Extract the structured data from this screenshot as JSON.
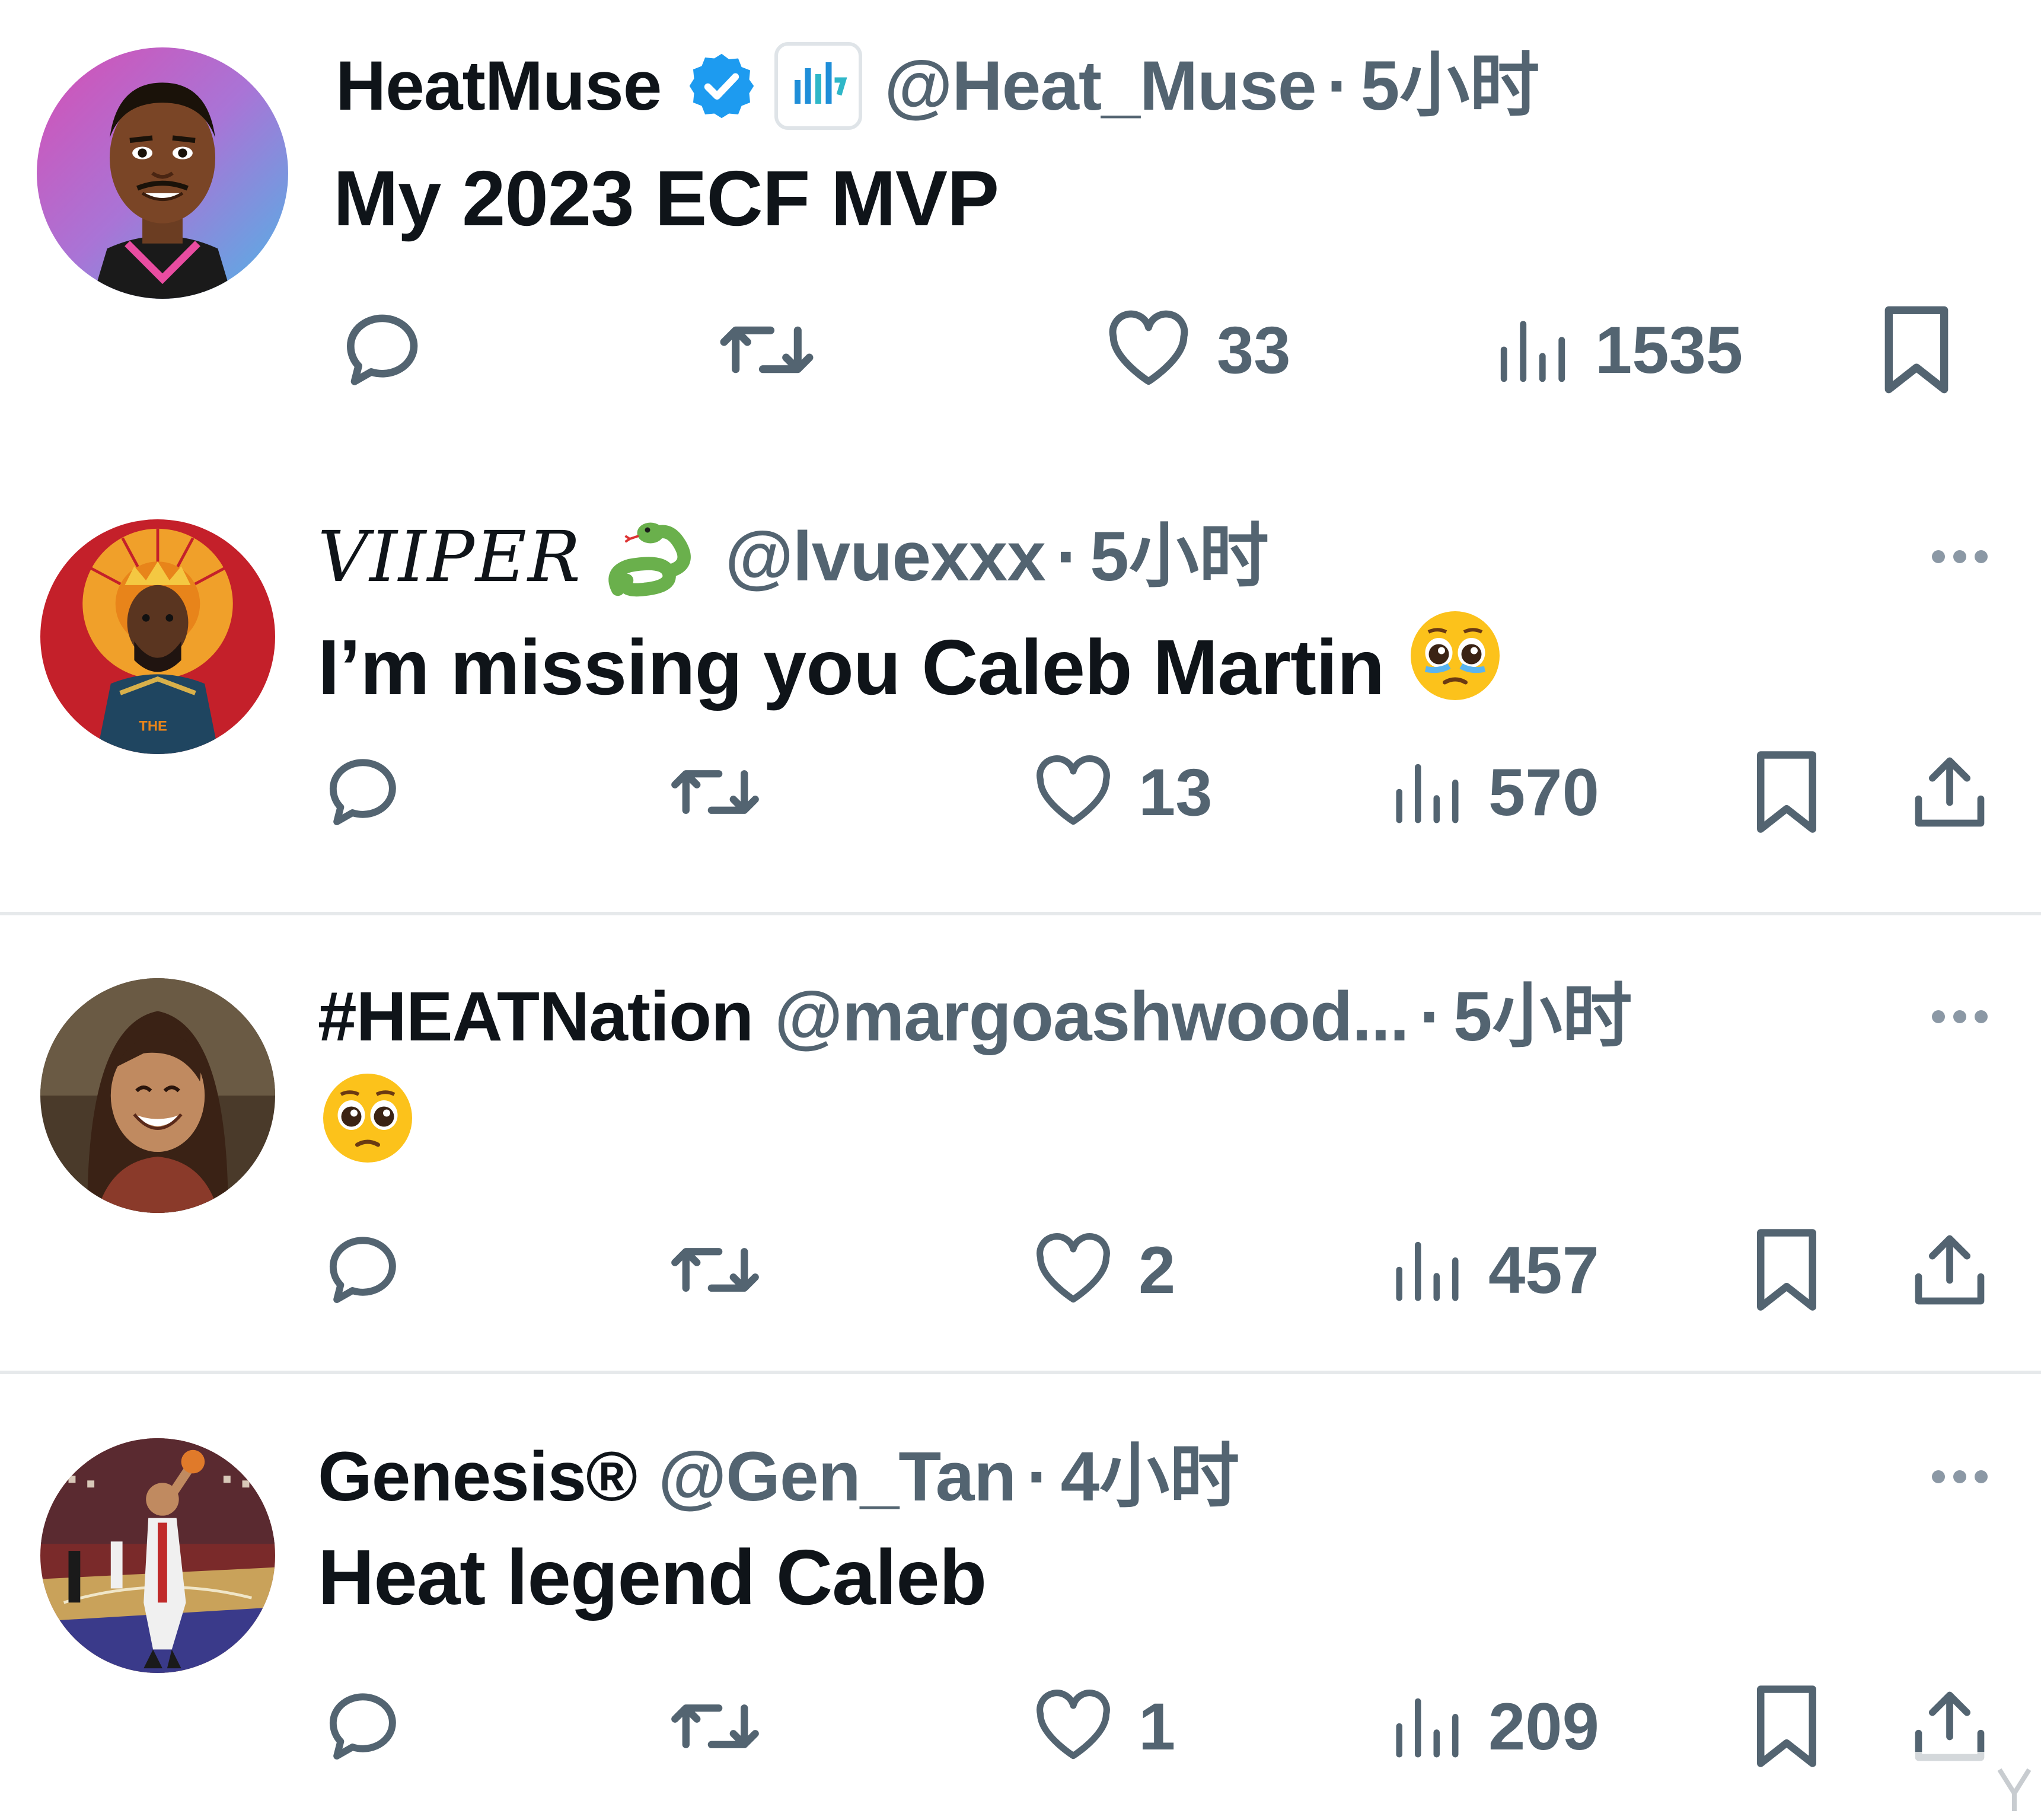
{
  "tweets": [
    {
      "name": "HeatMuse",
      "handle": "@Heat_Muse",
      "dot": "·",
      "time": "5小时",
      "text": "My 2023 ECF MVP",
      "avatar": "avatar-illustration-player",
      "verified": true,
      "badge_icon": "analytics-badge-icon",
      "likes": "33",
      "views": "1535",
      "has_more": false,
      "has_share": false
    },
    {
      "name": "VIIPER",
      "name_emoji": "snake-emoji",
      "handle": "@lvuexxx",
      "dot": "·",
      "time": "5小时",
      "text": "I’m missing you Caleb Martin",
      "text_emoji": "pleading-face-tears-emoji",
      "avatar": "avatar-king-portrait",
      "likes": "13",
      "views": "570",
      "has_more": true,
      "has_share": true
    },
    {
      "name": "#HEATNation",
      "handle": "@margoashwood...",
      "dot": "·",
      "time": "5小时",
      "text": "",
      "text_emoji": "pleading-face-emoji",
      "avatar": "avatar-smiling-girl",
      "likes": "2",
      "views": "457",
      "has_more": true,
      "has_share": true
    },
    {
      "name": "Genesis®",
      "handle": "@Gen_Tan",
      "dot": "·",
      "time": "4小时",
      "text": "Heat legend Caleb",
      "avatar": "avatar-basketball-court",
      "likes": "1",
      "views": "209",
      "has_more": true,
      "has_share": true
    }
  ],
  "colors": {
    "text_primary": "#0f1419",
    "text_secondary": "#536471",
    "verified_blue": "#1d9bf0",
    "divider": "#e6e9eb"
  },
  "icons": {
    "reply": "reply-icon",
    "retweet": "retweet-icon",
    "like": "heart-icon",
    "views": "views-icon",
    "bookmark": "bookmark-icon",
    "share": "share-icon",
    "more": "more-dots-icon"
  }
}
